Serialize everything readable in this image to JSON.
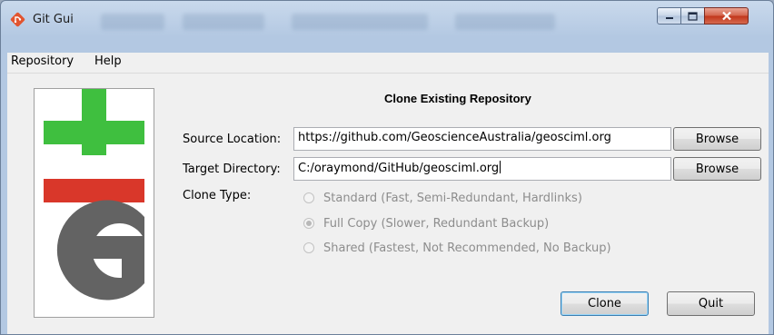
{
  "window": {
    "title": "Git Gui",
    "icon": "git-diamond-icon",
    "controls": [
      "minimize-icon",
      "maximize-icon",
      "close-icon"
    ]
  },
  "menubar": {
    "items": [
      "Repository",
      "Help"
    ]
  },
  "dialog": {
    "heading": "Clone Existing Repository",
    "source": {
      "label": "Source Location:",
      "value": "https://github.com/GeoscienceAustralia/geosciml.org",
      "button": "Browse"
    },
    "target": {
      "label": "Target Directory:",
      "value": "C:/oraymond/GitHub/geosciml.org",
      "button": "Browse"
    },
    "clone_type": {
      "label": "Clone Type:",
      "options": [
        "Standard (Fast, Semi-Redundant, Hardlinks)",
        "Full Copy (Slower, Redundant Backup)",
        "Shared (Fastest, Not Recommended, No Backup)"
      ],
      "selected": "Full Copy (Slower, Redundant Backup)"
    },
    "buttons": {
      "clone": "Clone",
      "quit": "Quit"
    }
  },
  "colors": {
    "logo_green": "#3fbf3f",
    "logo_red": "#d9372a",
    "logo_gray": "#636363",
    "close_red": "#c1351a"
  }
}
